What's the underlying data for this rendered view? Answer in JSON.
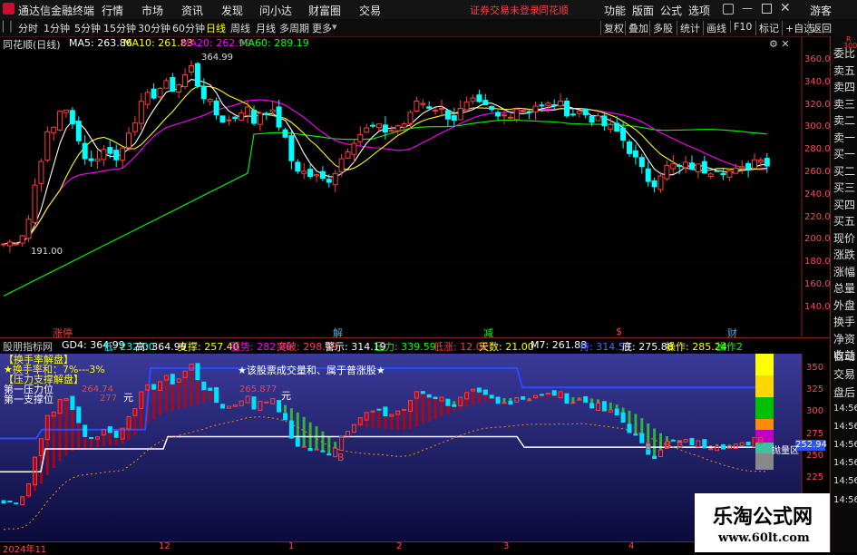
{
  "titlebar": {
    "app_title": "通达信金融终端",
    "menus": [
      "行情",
      "市场",
      "资讯",
      "发现",
      "问小达",
      "财富圈",
      "交易"
    ],
    "alert": "证券交易未登录",
    "stock": "同花顺",
    "right_menus": [
      "功能",
      "版面",
      "公式",
      "选项"
    ],
    "guest": "游客"
  },
  "toolbar": {
    "periods": [
      "分时",
      "1分钟",
      "5分钟",
      "15分钟",
      "30分钟",
      "60分钟",
      "日线",
      "周线",
      "月线",
      "多周期",
      "更多"
    ],
    "active_period": "日线",
    "right_items": [
      "复权",
      "叠加",
      "多股",
      "统计",
      "画线",
      "F10",
      "标记",
      "+自选",
      "返回"
    ]
  },
  "main_chart": {
    "name": "同花顺(日线)",
    "ma": [
      {
        "label": "MA5: 263.86",
        "color": "#ffffff"
      },
      {
        "label": "MA10: 261.83",
        "color": "#ffff00"
      },
      {
        "label": "MA20: 262.99",
        "color": "#ff00ff"
      },
      {
        "label": "MA60: 289.19",
        "color": "#00ff00"
      }
    ],
    "high_label": "364.99",
    "low_label": "191.00",
    "y_ticks": [
      "360.00",
      "340.00",
      "320.00",
      "300.00",
      "280.00",
      "260.00",
      "240.00",
      "220.00",
      "200.00",
      "180.00",
      "160.00",
      "140.00"
    ],
    "events": [
      "涨停",
      "解",
      "减",
      "$",
      "财"
    ]
  },
  "indicator": {
    "name": "股朋指标网",
    "values": [
      {
        "label": "GD4: 364.99",
        "color": "#ffffff"
      },
      {
        "label": "低: 232.00",
        "color": "#00ffff"
      },
      {
        "label": "高: 364.99",
        "color": "#ffffff"
      },
      {
        "label": "支撑: 257.40",
        "color": "#ffff00"
      },
      {
        "label": "强势: 282.80",
        "color": "#ff00ff"
      },
      {
        "label": "突破: 298.49",
        "color": "#ff3c3c"
      },
      {
        "label": "警示: 314.19",
        "color": "#ffffff"
      },
      {
        "label": "压力: 339.59",
        "color": "#00ff00"
      },
      {
        "label": "低涨: 12.02",
        "color": "#ff3c3c"
      },
      {
        "label": "天数: 21.00",
        "color": "#ffff00"
      },
      {
        "label": "M7: 261.88",
        "color": "#ffffff"
      },
      {
        "label": "持: 314.59",
        "color": "#4a6cff"
      },
      {
        "label": "底: 275.88",
        "color": "#ffffff"
      },
      {
        "label": "操作: 285.24",
        "color": "#ffff00"
      },
      {
        "label": "操作2",
        "color": "#00ff00"
      }
    ],
    "legend": [
      "【换手率解盘】",
      "★换手率和：7%---3%",
      "【压力支撑解盘】",
      "第一压力位",
      "第一支撑位"
    ],
    "note": "★该股票成交量和、属于普涨股★",
    "annotations": [
      "264.74",
      "277",
      "265.877",
      "元",
      "元"
    ],
    "current_price": "252.94",
    "current_label": "抛量区",
    "y_ticks": [
      "350",
      "325",
      "300",
      "275",
      "250",
      "225"
    ]
  },
  "x_axis": {
    "labels": [
      "2024年11",
      "12",
      "1",
      "2",
      "3",
      "4"
    ]
  },
  "side_panel": {
    "items": [
      "委比",
      "卖五",
      "卖四",
      "卖三",
      "卖二",
      "卖一",
      "买一",
      "买二",
      "买三",
      "买四",
      "买五",
      "现价",
      "涨跌",
      "涨幅",
      "总量",
      "外盘",
      "换手",
      "净资",
      "收益",
      "自动",
      "交易",
      "盘后",
      "14:56",
      "14:56",
      "14:56",
      "14:56",
      "14:56",
      "14:56"
    ],
    "top_label": "R",
    "top_value": "300"
  },
  "ad": {
    "title": "乐淘公式网",
    "url": "www.60lt.com"
  },
  "colors": {
    "up": "#ff3c3c",
    "down": "#00ffff",
    "ma5": "#ffffff",
    "ma10": "#ffff00",
    "ma20": "#ff00ff",
    "ma60": "#00ff00"
  }
}
